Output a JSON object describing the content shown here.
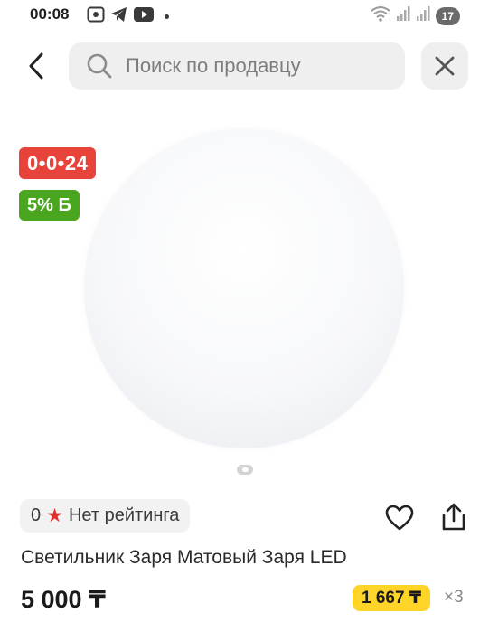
{
  "status_bar": {
    "time": "00:08",
    "icons_left": [
      "screenshot-icon",
      "telegram-icon",
      "youtube-icon"
    ],
    "icons_right": [
      "wifi-icon",
      "signal-icon",
      "signal-icon"
    ],
    "battery": "17"
  },
  "header": {
    "search_placeholder": "Поиск по продавцу"
  },
  "product": {
    "timer_badge": "0•0•24",
    "bonus_badge": "5% Б",
    "rating": {
      "value": "0",
      "text": "Нет рейтинга"
    },
    "title": "Светильник Заря Матовый Заря LED",
    "price": "5 000 ₸",
    "installment": {
      "amount": "1 667 ₸",
      "multiplier": "×3"
    },
    "gallery": {
      "page_count": 1,
      "current_page": 1
    }
  },
  "colors": {
    "timer_badge": "#e8433b",
    "bonus_badge": "#4aa61f",
    "installment_chip": "#ffd428",
    "rating_star": "#e52e2e"
  }
}
